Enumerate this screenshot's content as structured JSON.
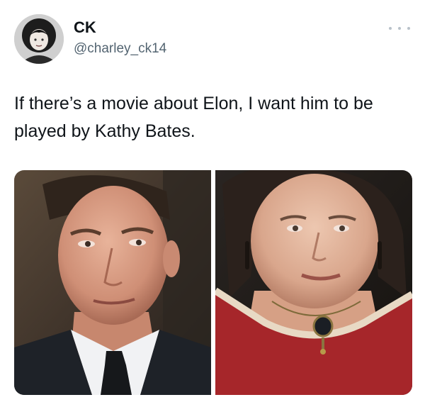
{
  "tweet": {
    "author": {
      "display_name": "CK",
      "handle": "@charley_ck14"
    },
    "text": "If there’s a movie about Elon, I want him to be played by Kathy Bates.",
    "media": [
      {
        "icon": "photo-man-in-suit"
      },
      {
        "icon": "photo-woman-in-red-dress"
      }
    ],
    "more_icon": "more-horizontal-icon"
  },
  "colors": {
    "text": "#0f1419",
    "secondary_text": "#536471",
    "more_dots": "#b8c1c9"
  }
}
